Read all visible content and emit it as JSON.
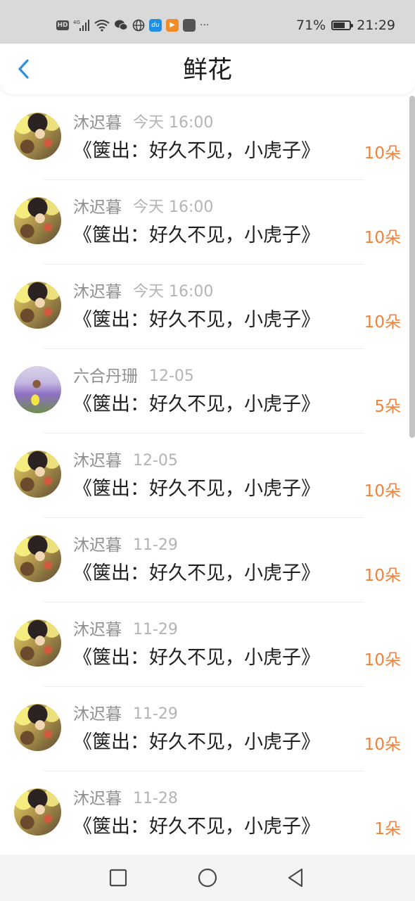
{
  "status_bar": {
    "hd": "HD",
    "signal": "4G",
    "app_du": "du",
    "more": "···",
    "battery_percent": "71%",
    "battery_level": 0.71,
    "time": "21:29"
  },
  "header": {
    "title": "鲜花"
  },
  "flowers": [
    {
      "user": "沐迟暮",
      "date": "今天 16:00",
      "book": "《箧出：好久不见，小虎子》",
      "count": "10朵",
      "avatar": "anime"
    },
    {
      "user": "沐迟暮",
      "date": "今天 16:00",
      "book": "《箧出：好久不见，小虎子》",
      "count": "10朵",
      "avatar": "anime"
    },
    {
      "user": "沐迟暮",
      "date": "今天 16:00",
      "book": "《箧出：好久不见，小虎子》",
      "count": "10朵",
      "avatar": "anime"
    },
    {
      "user": "六合丹珊",
      "date": "12-05",
      "book": "《箧出：好久不见，小虎子》",
      "count": "5朵",
      "avatar": "field"
    },
    {
      "user": "沐迟暮",
      "date": "12-05",
      "book": "《箧出：好久不见，小虎子》",
      "count": "10朵",
      "avatar": "anime"
    },
    {
      "user": "沐迟暮",
      "date": "11-29",
      "book": "《箧出：好久不见，小虎子》",
      "count": "10朵",
      "avatar": "anime"
    },
    {
      "user": "沐迟暮",
      "date": "11-29",
      "book": "《箧出：好久不见，小虎子》",
      "count": "10朵",
      "avatar": "anime"
    },
    {
      "user": "沐迟暮",
      "date": "11-29",
      "book": "《箧出：好久不见，小虎子》",
      "count": "10朵",
      "avatar": "anime"
    },
    {
      "user": "沐迟暮",
      "date": "11-28",
      "book": "《箧出：好久不见，小虎子》",
      "count": "1朵",
      "avatar": "anime"
    }
  ],
  "colors": {
    "accent": "#2f8fe0",
    "count": "#f0823a",
    "status_bar_bg": "#d9d9d9"
  },
  "icons": {
    "back": "chevron-left-icon",
    "recent_apps": "square-icon",
    "home": "circle-icon",
    "back_nav": "triangle-left-icon"
  }
}
